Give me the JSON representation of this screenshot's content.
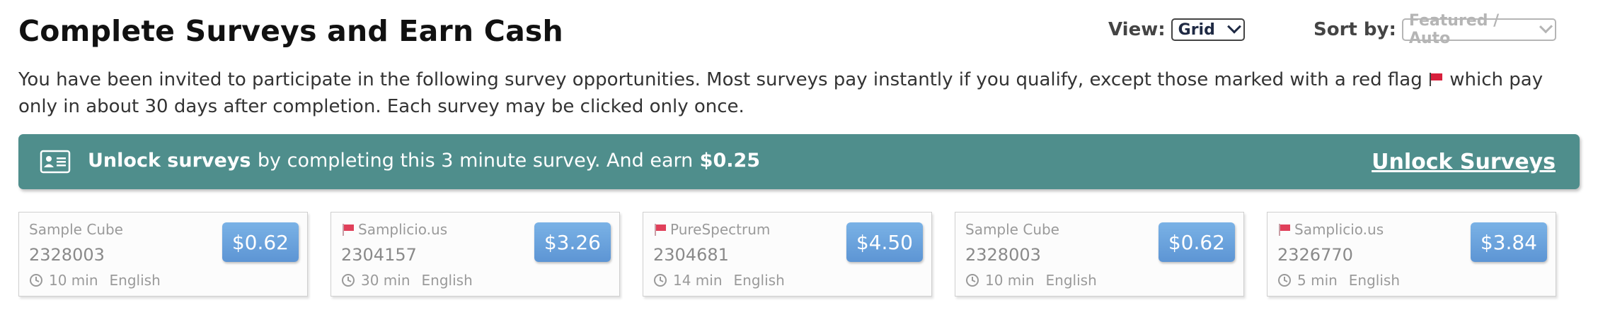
{
  "header": {
    "title": "Complete Surveys and Earn Cash",
    "view_label": "View:",
    "view_value": "Grid",
    "sort_label": "Sort by:",
    "sort_value": "Featured / Auto"
  },
  "intro": {
    "part1": "You have been invited to participate in the following survey opportunities. Most surveys pay instantly if you qualify, except those marked with a red flag",
    "part2": "which pay only in about 30 days after completion. Each survey may be clicked only once."
  },
  "banner": {
    "bold": "Unlock surveys",
    "middle": "by completing this 3 minute survey. And earn",
    "amount": "$0.25",
    "link": "Unlock Surveys"
  },
  "colors": {
    "banner": "#4f8e8c",
    "price": "#6aa3dd",
    "flag": "#e0405a"
  },
  "cards": [
    {
      "provider": "Sample Cube",
      "flag": false,
      "id": "2328003",
      "price": "$0.62",
      "duration": "10 min",
      "language": "English"
    },
    {
      "provider": "Samplicio.us",
      "flag": true,
      "id": "2304157",
      "price": "$3.26",
      "duration": "30 min",
      "language": "English"
    },
    {
      "provider": "PureSpectrum",
      "flag": true,
      "id": "2304681",
      "price": "$4.50",
      "duration": "14 min",
      "language": "English"
    },
    {
      "provider": "Sample Cube",
      "flag": false,
      "id": "2328003",
      "price": "$0.62",
      "duration": "10 min",
      "language": "English"
    },
    {
      "provider": "Samplicio.us",
      "flag": true,
      "id": "2326770",
      "price": "$3.84",
      "duration": "5 min",
      "language": "English"
    }
  ]
}
